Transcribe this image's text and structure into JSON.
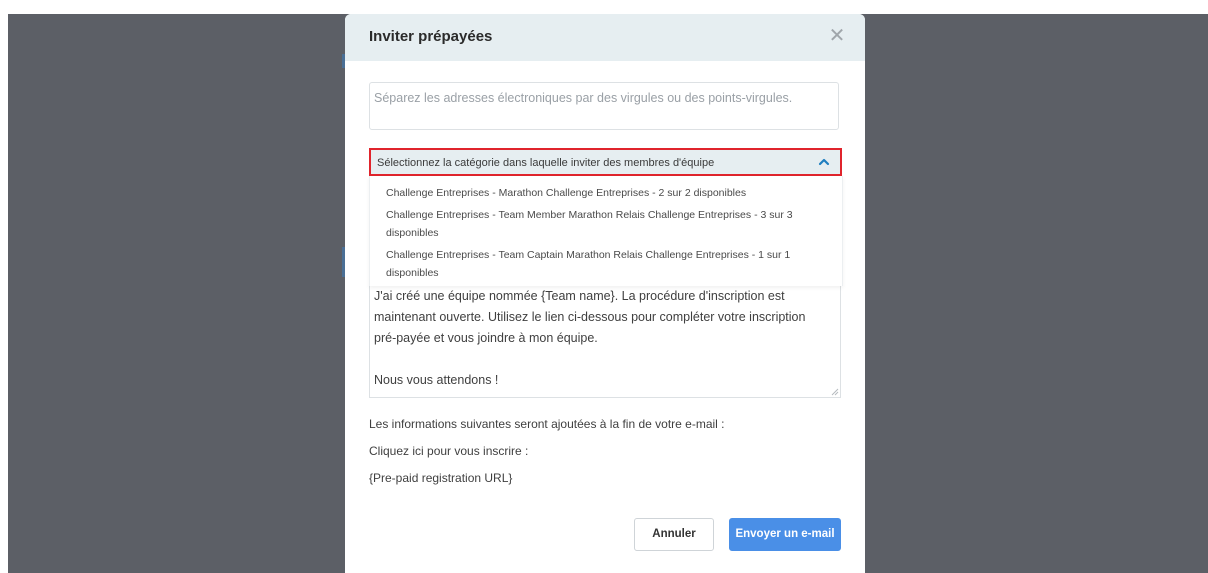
{
  "colors": {
    "backdrop": "#5c5f66",
    "header_bg": "#e6eef1",
    "highlight_border": "#e0242c",
    "primary_button": "#4a8fe7",
    "chevron": "#1f7fc0"
  },
  "modal": {
    "title": "Inviter prépayées",
    "close_icon": "close-icon"
  },
  "emails": {
    "placeholder": "Séparez les adresses électroniques par des virgules ou des points-virgules.",
    "value": ""
  },
  "category": {
    "selected_label": "Sélectionnez la catégorie dans laquelle inviter des membres d'équipe",
    "icon": "chevron-up-icon",
    "options": [
      {
        "line1": "Challenge Entreprises - Marathon Challenge Entreprises - 2 sur 2 disponibles",
        "line2": ""
      },
      {
        "line1": "Challenge Entreprises - Team Member Marathon Relais Challenge Entreprises - 3 sur 3",
        "line2": "disponibles"
      },
      {
        "line1": "Challenge Entreprises - Team Captain Marathon Relais Challenge Entreprises - 1 sur 1",
        "line2": "disponibles"
      }
    ]
  },
  "message": {
    "lines": [
      "J'ai créé une équipe nommée {Team name}. La procédure d'inscription est",
      "maintenant ouverte. Utilisez le lien ci-dessous pour compléter votre inscription",
      "pré-payée et vous joindre à mon équipe.",
      "",
      "Nous vous attendons !"
    ]
  },
  "footer_info": {
    "intro": "Les informations suivantes seront ajoutées à la fin de votre e-mail :",
    "cta": "Cliquez ici pour vous inscrire :",
    "url_token": "{Pre-paid registration URL}"
  },
  "buttons": {
    "cancel": "Annuler",
    "send": "Envoyer un e-mail"
  }
}
